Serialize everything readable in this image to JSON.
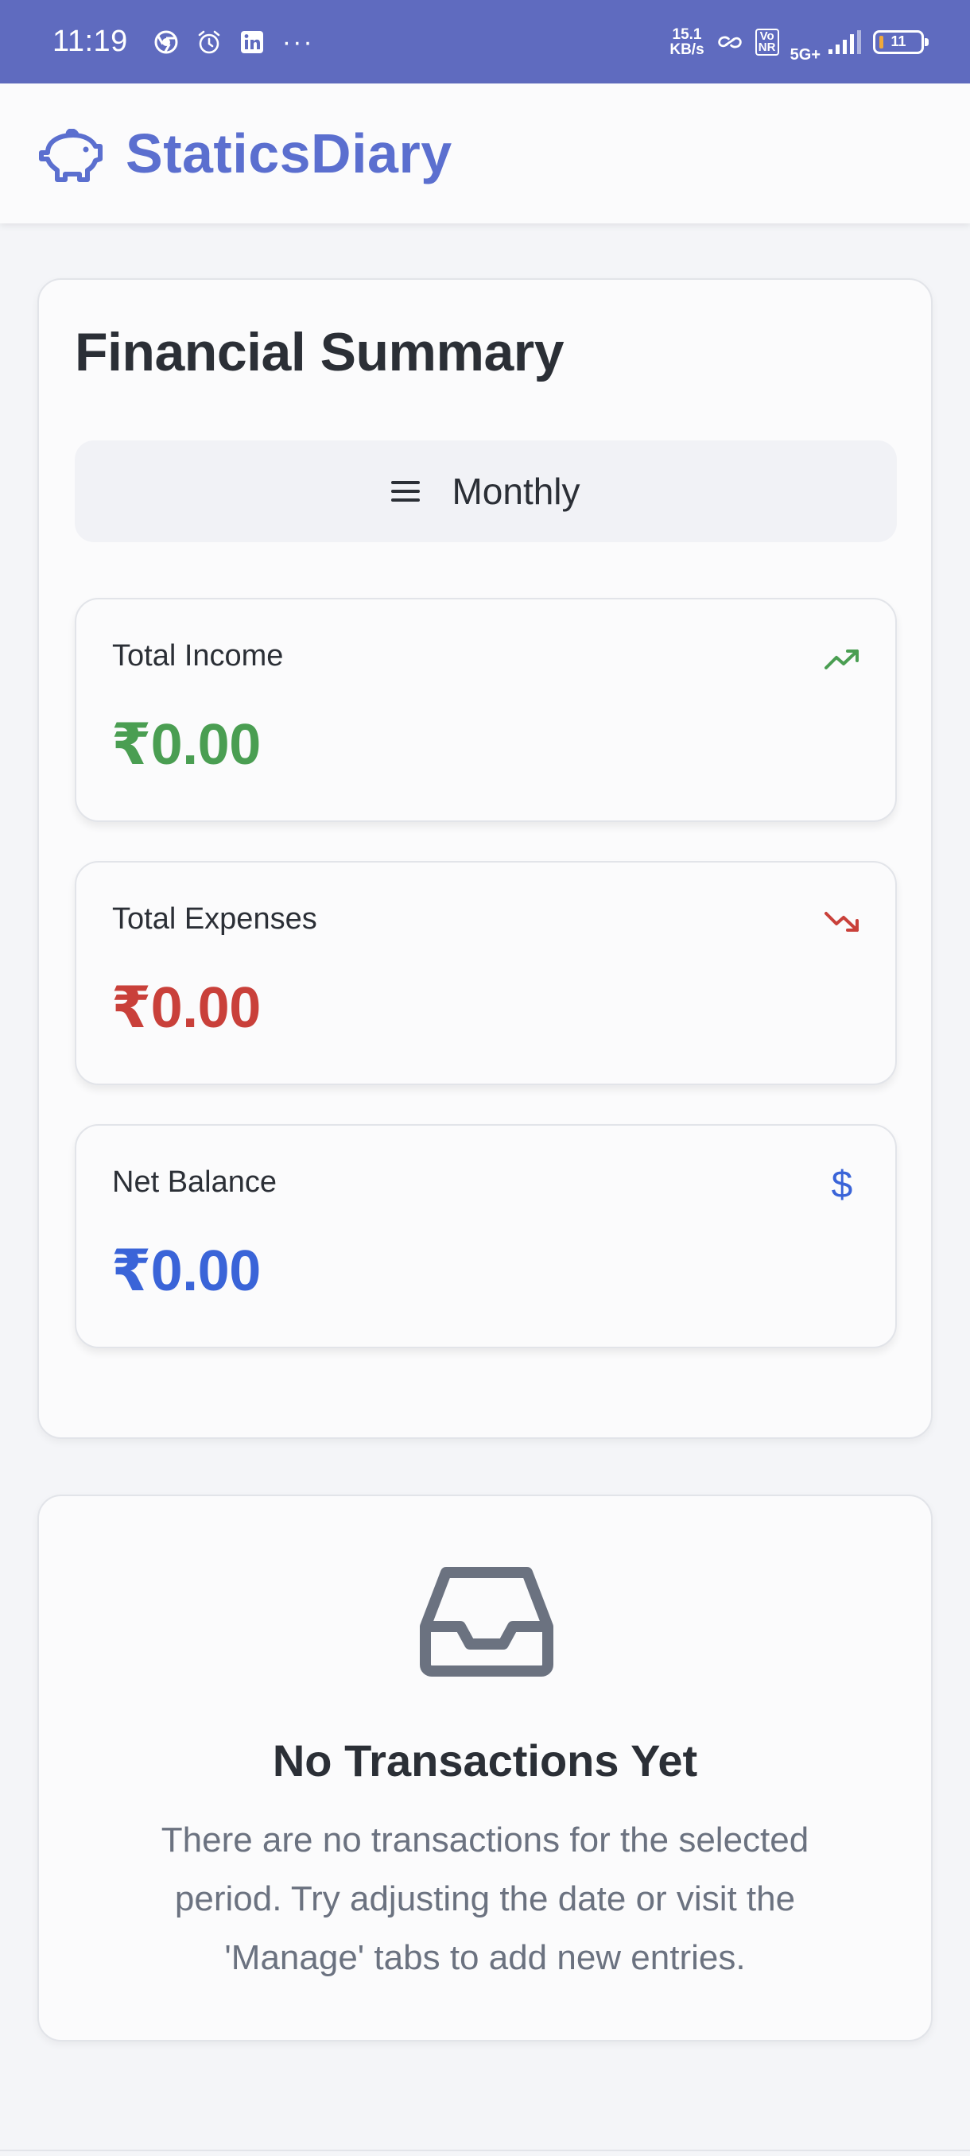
{
  "status_bar": {
    "time": "11:19",
    "net_speed_value": "15.1",
    "net_speed_unit": "KB/s",
    "volte_top": "Vo",
    "volte_bottom": "NR",
    "network": "5G+",
    "battery": "11"
  },
  "header": {
    "app_title": "StaticsDiary"
  },
  "summary": {
    "title": "Financial Summary",
    "period_label": "Monthly",
    "income": {
      "label": "Total Income",
      "value": "₹0.00",
      "color": "#4a9e52"
    },
    "expenses": {
      "label": "Total Expenses",
      "value": "₹0.00",
      "color": "#c9403a"
    },
    "balance": {
      "label": "Net Balance",
      "value": "₹0.00",
      "color": "#3a64d8",
      "icon_text": "$"
    }
  },
  "empty_state": {
    "title": "No Transactions Yet",
    "message": "There are no transactions for the selected period. Try adjusting the date or visit the 'Manage' tabs to add new entries."
  },
  "icons": {
    "logo": "piggy-bank-icon",
    "period": "menu-icon",
    "income": "trending-up-icon",
    "expenses": "trending-down-icon",
    "balance": "dollar-icon",
    "empty": "inbox-icon"
  }
}
